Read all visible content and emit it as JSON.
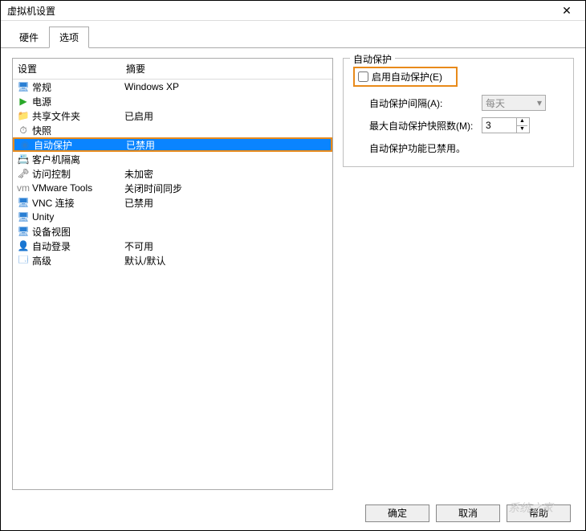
{
  "title": "虚拟机设置",
  "tabs": {
    "hardware": "硬件",
    "options": "选项"
  },
  "columns": {
    "name": "设置",
    "summary": "摘要"
  },
  "rows": [
    {
      "icon": "🖥",
      "iconClass": "ic-monitor",
      "name": "常规",
      "summary": "Windows XP"
    },
    {
      "icon": "▶",
      "iconClass": "ic-play",
      "name": "电源",
      "summary": ""
    },
    {
      "icon": "📁",
      "iconClass": "ic-folder",
      "name": "共享文件夹",
      "summary": "已启用"
    },
    {
      "icon": "⏱",
      "iconClass": "ic-snap",
      "name": "快照",
      "summary": ""
    },
    {
      "icon": "◉",
      "iconClass": "ic-auto",
      "name": "自动保护",
      "summary": "已禁用"
    },
    {
      "icon": "📇",
      "iconClass": "ic-guest",
      "name": "客户机隔离",
      "summary": ""
    },
    {
      "icon": "🗝",
      "iconClass": "ic-lock",
      "name": "访问控制",
      "summary": "未加密"
    },
    {
      "icon": "vm",
      "iconClass": "ic-vmw",
      "name": "VMware Tools",
      "summary": "关闭时间同步"
    },
    {
      "icon": "🖥",
      "iconClass": "ic-vnc",
      "name": "VNC 连接",
      "summary": "已禁用"
    },
    {
      "icon": "🖥",
      "iconClass": "ic-unity",
      "name": "Unity",
      "summary": ""
    },
    {
      "icon": "🖥",
      "iconClass": "ic-dev",
      "name": "设备视图",
      "summary": ""
    },
    {
      "icon": "👤",
      "iconClass": "ic-user",
      "name": "自动登录",
      "summary": "不可用"
    },
    {
      "icon": "🗔",
      "iconClass": "ic-adv",
      "name": "高级",
      "summary": "默认/默认"
    }
  ],
  "selectedIndex": 4,
  "group": {
    "title": "自动保护",
    "enable_label": "启用自动保护(E)",
    "interval_label": "自动保护间隔(A):",
    "interval_value": "每天",
    "max_label": "最大自动保护快照数(M):",
    "max_value": "3",
    "status": "自动保护功能已禁用。"
  },
  "buttons": {
    "ok": "确定",
    "cancel": "取消",
    "help": "帮助"
  },
  "watermark": "系统之家"
}
